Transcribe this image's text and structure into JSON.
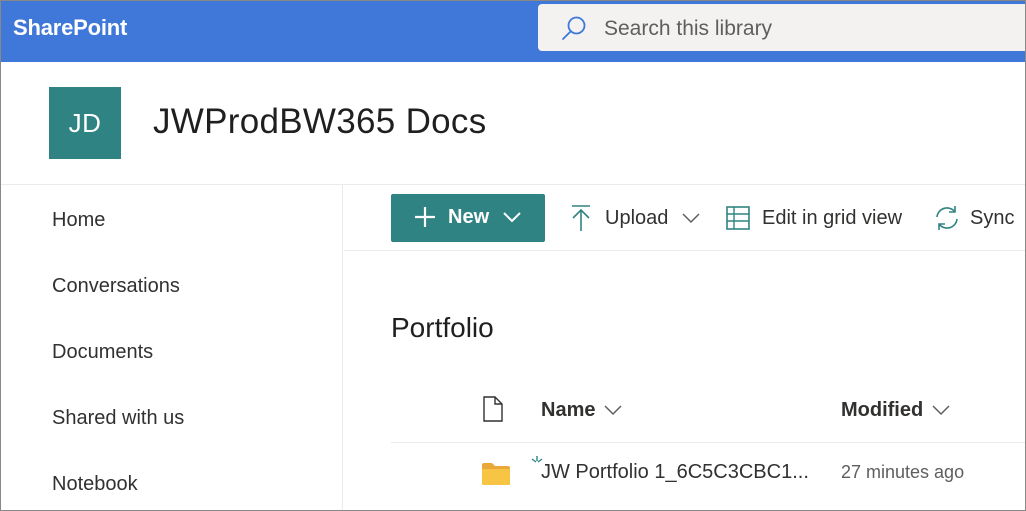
{
  "suite_bar": {
    "brand": "SharePoint",
    "search_placeholder": "Search this library"
  },
  "site": {
    "logo_initials": "JD",
    "title": "JWProdBW365 Docs"
  },
  "left_nav": {
    "items": [
      {
        "label": "Home"
      },
      {
        "label": "Conversations"
      },
      {
        "label": "Documents"
      },
      {
        "label": "Shared with us"
      },
      {
        "label": "Notebook"
      }
    ]
  },
  "command_bar": {
    "new_label": "New",
    "upload_label": "Upload",
    "grid_label": "Edit in grid view",
    "sync_label": "Sync"
  },
  "library": {
    "title": "Portfolio",
    "columns": {
      "name": "Name",
      "modified": "Modified"
    },
    "rows": [
      {
        "name": "JW Portfolio 1_6C5C3CBC1...",
        "modified": "27 minutes ago",
        "icon": "folder-icon",
        "is_new": true
      }
    ]
  },
  "colors": {
    "suite_bar": "#3f78d8",
    "teal_accent": "#2f8382",
    "folder": "#f7c443"
  }
}
